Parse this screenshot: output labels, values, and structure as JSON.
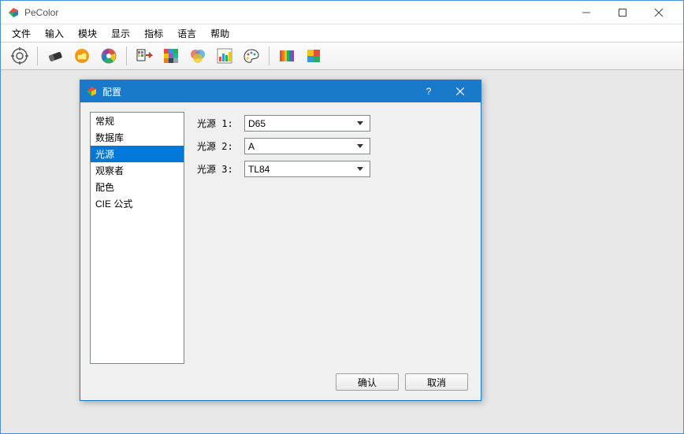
{
  "app": {
    "title": "PeColor"
  },
  "menu": {
    "items": [
      "文件",
      "输入",
      "模块",
      "显示",
      "指标",
      "语言",
      "帮助"
    ]
  },
  "toolbar": {
    "icons": [
      "gear-icon",
      "eraser-icon",
      "folder-icon",
      "color-wheel-icon",
      "palette-output-icon",
      "grid-swatch-icon",
      "venn-icon",
      "chart-icon",
      "paint-palette-icon",
      "spectrum-icon",
      "color-block-icon"
    ]
  },
  "dialog": {
    "title": "配置",
    "categories": [
      "常规",
      "数据库",
      "光源",
      "观察者",
      "配色",
      "CIE 公式"
    ],
    "selected_category_index": 2,
    "settings": {
      "rows": [
        {
          "label": "光源 1:",
          "value": "D65"
        },
        {
          "label": "光源 2:",
          "value": "A"
        },
        {
          "label": "光源 3:",
          "value": "TL84"
        }
      ]
    },
    "buttons": {
      "ok": "确认",
      "cancel": "取消"
    }
  }
}
